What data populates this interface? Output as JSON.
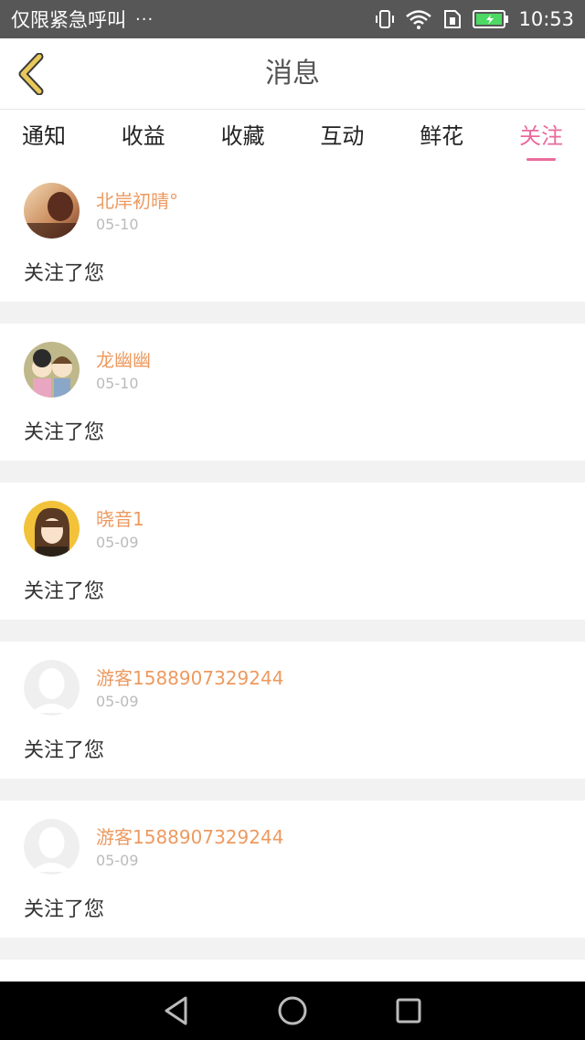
{
  "status_bar": {
    "carrier": "仅限紧急呼叫",
    "more": "···",
    "time": "10:53",
    "icons": [
      "vibrate-icon",
      "wifi-icon",
      "sim-icon",
      "battery-icon"
    ]
  },
  "header": {
    "title": "消息",
    "back_icon": "chevron-left-icon",
    "back_color": "#e0b84a"
  },
  "tabs": [
    {
      "label": "通知",
      "active": false
    },
    {
      "label": "收益",
      "active": false
    },
    {
      "label": "收藏",
      "active": false
    },
    {
      "label": "互动",
      "active": false
    },
    {
      "label": "鲜花",
      "active": false
    },
    {
      "label": "关注",
      "active": true
    }
  ],
  "accent_color": "#e96b9c",
  "name_color": "#ed9a60",
  "messages": [
    {
      "name": "北岸初晴°",
      "date": "05-10",
      "text": "关注了您",
      "avatar": "photo-avatar"
    },
    {
      "name": "龙幽幽",
      "date": "05-10",
      "text": "关注了您",
      "avatar": "cartoon-avatar"
    },
    {
      "name": "晓音1",
      "date": "05-09",
      "text": "关注了您",
      "avatar": "anime-avatar"
    },
    {
      "name": "游客1588907329244",
      "date": "05-09",
      "text": "关注了您",
      "avatar": "default-avatar"
    },
    {
      "name": "游客1588907329244",
      "date": "05-09",
      "text": "关注了您",
      "avatar": "default-avatar"
    }
  ],
  "nav_bar": {
    "buttons": [
      "back-triangle-icon",
      "home-circle-icon",
      "recents-square-icon"
    ]
  }
}
